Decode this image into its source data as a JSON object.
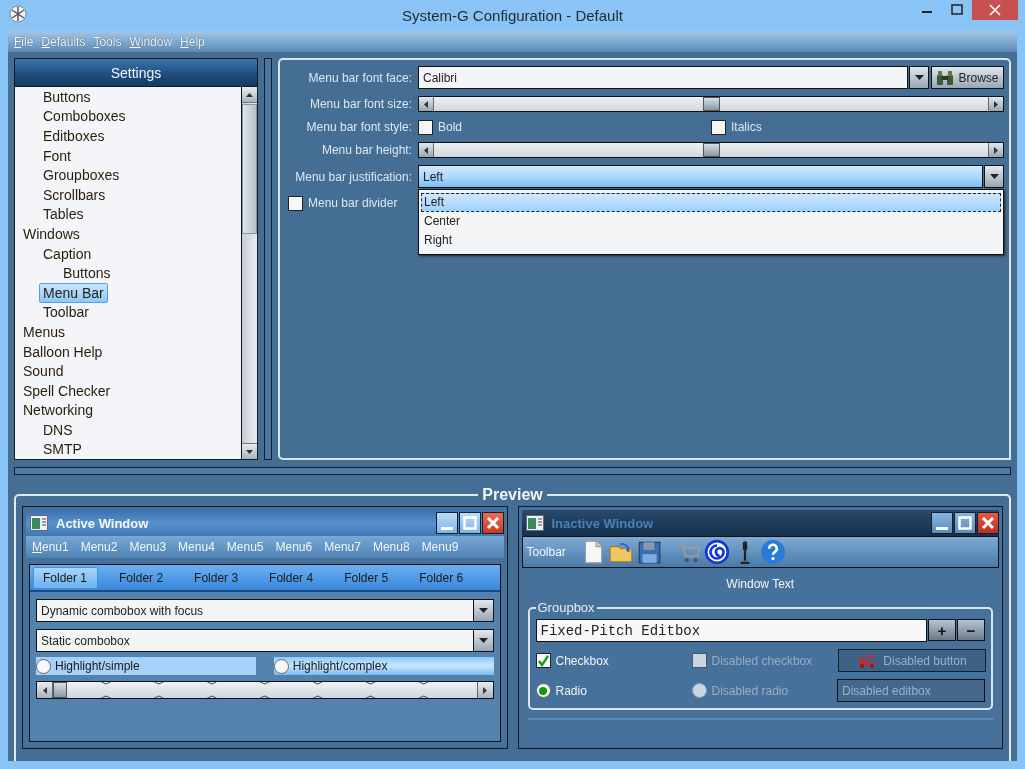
{
  "window": {
    "title": "System-G Configuration - Default"
  },
  "menu": [
    "File",
    "Defaults",
    "Tools",
    "Window",
    "Help"
  ],
  "settings": {
    "title": "Settings",
    "items": [
      {
        "children": [
          {
            "label": "Buttons",
            "selected": false
          },
          {
            "label": "Comboboxes",
            "selected": false
          },
          {
            "label": "Editboxes",
            "selected": false
          },
          {
            "label": "Font",
            "selected": false
          },
          {
            "label": "Groupboxes",
            "selected": false
          },
          {
            "label": "Scrollbars",
            "selected": false
          },
          {
            "label": "Tables",
            "selected": false
          }
        ]
      },
      {
        "label": "Windows",
        "selected": false,
        "children": [
          {
            "label": "Caption",
            "selected": false,
            "children": [
              {
                "label": "Buttons",
                "selected": false
              }
            ]
          },
          {
            "label": "Menu Bar",
            "selected": true
          },
          {
            "label": "Toolbar",
            "selected": false
          }
        ]
      },
      {
        "label": "Menus",
        "selected": false
      },
      {
        "label": "Balloon Help",
        "selected": false
      },
      {
        "label": "Sound",
        "selected": false
      },
      {
        "label": "Spell Checker",
        "selected": false
      },
      {
        "label": "Networking",
        "selected": false,
        "children": [
          {
            "label": "DNS",
            "selected": false
          },
          {
            "label": "SMTP",
            "selected": false
          }
        ]
      }
    ]
  },
  "form": {
    "rows": [
      {
        "kind": "combo",
        "label": "Menu bar font face:",
        "value": "Calibri",
        "button": "Browse"
      },
      {
        "kind": "slider",
        "label": "Menu bar font size:",
        "level": 0.5
      },
      {
        "kind": "checks",
        "label": "Menu bar font style:",
        "options": [
          {
            "label": "Bold",
            "checked": false
          },
          {
            "label": "Italics",
            "checked": false
          }
        ]
      },
      {
        "kind": "slider",
        "label": "Menu bar height:",
        "level": 0.5
      },
      {
        "kind": "dropdown",
        "label": "Menu bar justification:",
        "value": "Left",
        "options": [
          {
            "label": "Left",
            "selected": true
          },
          {
            "label": "Center",
            "selected": false
          },
          {
            "label": "Right",
            "selected": false
          }
        ]
      },
      {
        "kind": "check",
        "label": "Menu bar divider",
        "checked": false
      }
    ]
  },
  "preview": {
    "title": "Preview",
    "active_window": {
      "title": "Active Window",
      "menus": [
        "Menu1",
        "Menu2",
        "Menu3",
        "Menu4",
        "Menu5",
        "Menu6",
        "Menu7",
        "Menu8",
        "Menu9"
      ],
      "tabs": [
        {
          "label": "Folder 1",
          "selected": true
        },
        {
          "label": "Folder 2",
          "selected": false
        },
        {
          "label": "Folder 3",
          "selected": false
        },
        {
          "label": "Folder 4",
          "selected": false
        },
        {
          "label": "Folder 5",
          "selected": false
        },
        {
          "label": "Folder 6",
          "selected": false
        }
      ],
      "combos": [
        "Dynamic combobox with focus",
        "Static combobox"
      ],
      "radios": [
        {
          "kind": "simple",
          "label": "Highlight/simple",
          "selected": false
        },
        {
          "kind": "complex",
          "label": "Highlight/complex",
          "selected": false
        }
      ],
      "slider": {
        "level": 0
      }
    },
    "inactive_window": {
      "title": "Inactive Window",
      "toolbar_label": "Toolbar",
      "window_text": "Window Text",
      "groupbox": {
        "title": "Groupbox",
        "editbox": "Fixed-Pitch Editbox",
        "spin_buttons": [
          "+",
          "−"
        ],
        "controls": [
          {
            "kind": "checkbox",
            "label": "Checkbox",
            "checked": true,
            "disabled": false
          },
          {
            "kind": "checkbox",
            "label": "Disabled checkbox",
            "checked": false,
            "disabled": true
          },
          {
            "kind": "button",
            "label": "Disabled button",
            "disabled": true
          },
          {
            "kind": "radio",
            "label": "Radio",
            "selected": true,
            "disabled": false
          },
          {
            "kind": "radio",
            "label": "Disabled radio",
            "selected": false,
            "disabled": true
          },
          {
            "kind": "editbox",
            "value": "Disabled editbox",
            "disabled": true
          }
        ]
      }
    }
  }
}
